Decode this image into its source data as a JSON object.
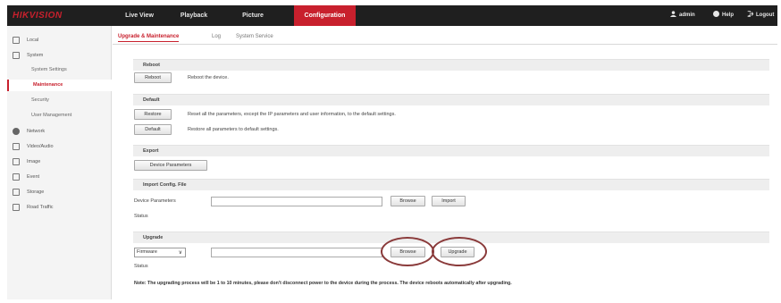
{
  "header": {
    "logo": "HIKVISION",
    "tabs": [
      "Live View",
      "Playback",
      "Picture",
      "Configuration"
    ],
    "active_tab": "Configuration",
    "user": "admin",
    "help": "Help",
    "logout": "Logout"
  },
  "sidebar": {
    "items": {
      "local": "Local",
      "system": "System",
      "system_settings": "System Settings",
      "maintenance": "Maintenance",
      "security": "Security",
      "user_management": "User Management",
      "network": "Network",
      "video_audio": "Video/Audio",
      "image": "Image",
      "event": "Event",
      "storage": "Storage",
      "road_traffic": "Road Traffic"
    }
  },
  "main": {
    "tabs": {
      "upgrade": "Upgrade & Maintenance",
      "log": "Log",
      "system_service": "System Service"
    },
    "reboot": {
      "title": "Reboot",
      "button": "Reboot",
      "desc": "Reboot the device."
    },
    "default": {
      "title": "Default",
      "restore_button": "Restore",
      "restore_desc": "Reset all the parameters, except the IP parameters and user information, to the default settings.",
      "default_button": "Default",
      "default_desc": "Restore all parameters to default settings."
    },
    "export": {
      "title": "Export",
      "button": "Device Parameters"
    },
    "import": {
      "title": "Import Config. File",
      "label": "Device Parameters",
      "browse": "Browse",
      "import": "Import",
      "status": "Status"
    },
    "upgrade": {
      "title": "Upgrade",
      "select_value": "Firmware",
      "browse": "Browse",
      "upgrade": "Upgrade",
      "status": "Status"
    },
    "note": "Note: The upgrading process will be 1 to 10 minutes, please don't disconnect power to the device during the process. The device reboots automatically after upgrading."
  },
  "colors": {
    "brand_red": "#c8202d",
    "topbar": "#1f1f1f",
    "annotation_ring": "#8a3a3a"
  }
}
